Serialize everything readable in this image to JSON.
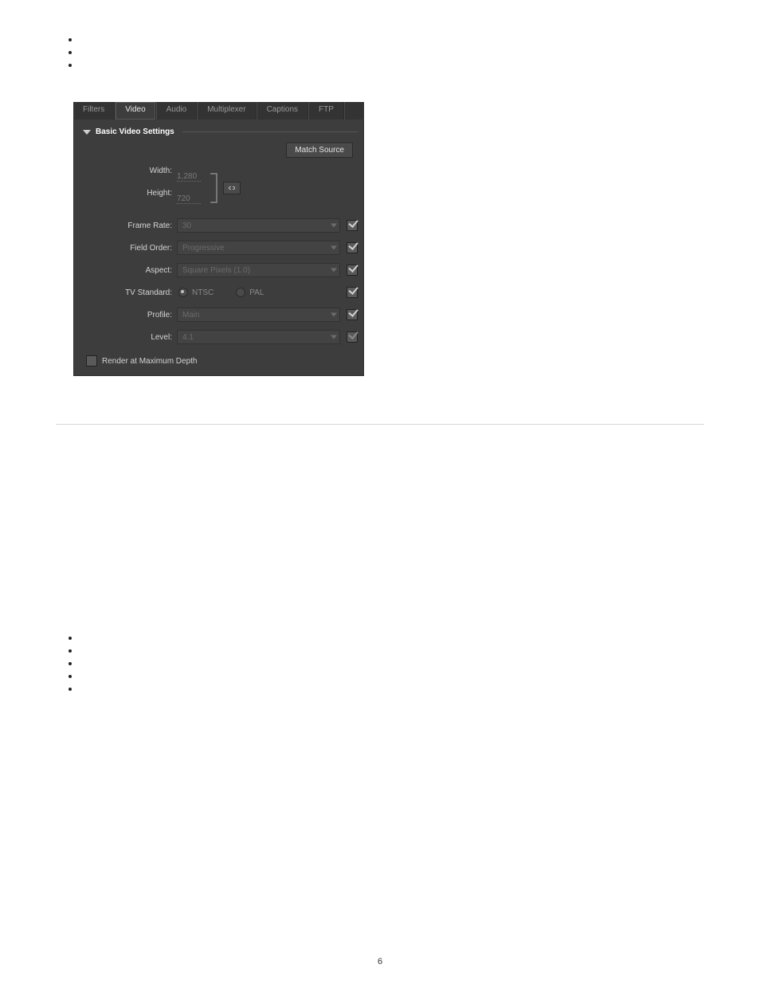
{
  "tabs": {
    "filters": "Filters",
    "video": "Video",
    "audio": "Audio",
    "multiplexer": "Multiplexer",
    "captions": "Captions",
    "ftp": "FTP"
  },
  "section": {
    "title": "Basic Video Settings",
    "match_source": "Match Source"
  },
  "fields": {
    "width": {
      "label": "Width:",
      "value": "1,280"
    },
    "height": {
      "label": "Height:",
      "value": "720"
    },
    "frame_rate": {
      "label": "Frame Rate:",
      "value": "30"
    },
    "field_order": {
      "label": "Field Order:",
      "value": "Progressive"
    },
    "aspect": {
      "label": "Aspect:",
      "value": "Square Pixels (1.0)"
    },
    "tv_standard": {
      "label": "TV Standard:",
      "options": {
        "ntsc": "NTSC",
        "pal": "PAL"
      },
      "selected": "ntsc"
    },
    "profile": {
      "label": "Profile:",
      "value": "Main"
    },
    "level": {
      "label": "Level:",
      "value": "4.1"
    }
  },
  "render_max_depth": "Render at Maximum Depth",
  "page_number": "6"
}
